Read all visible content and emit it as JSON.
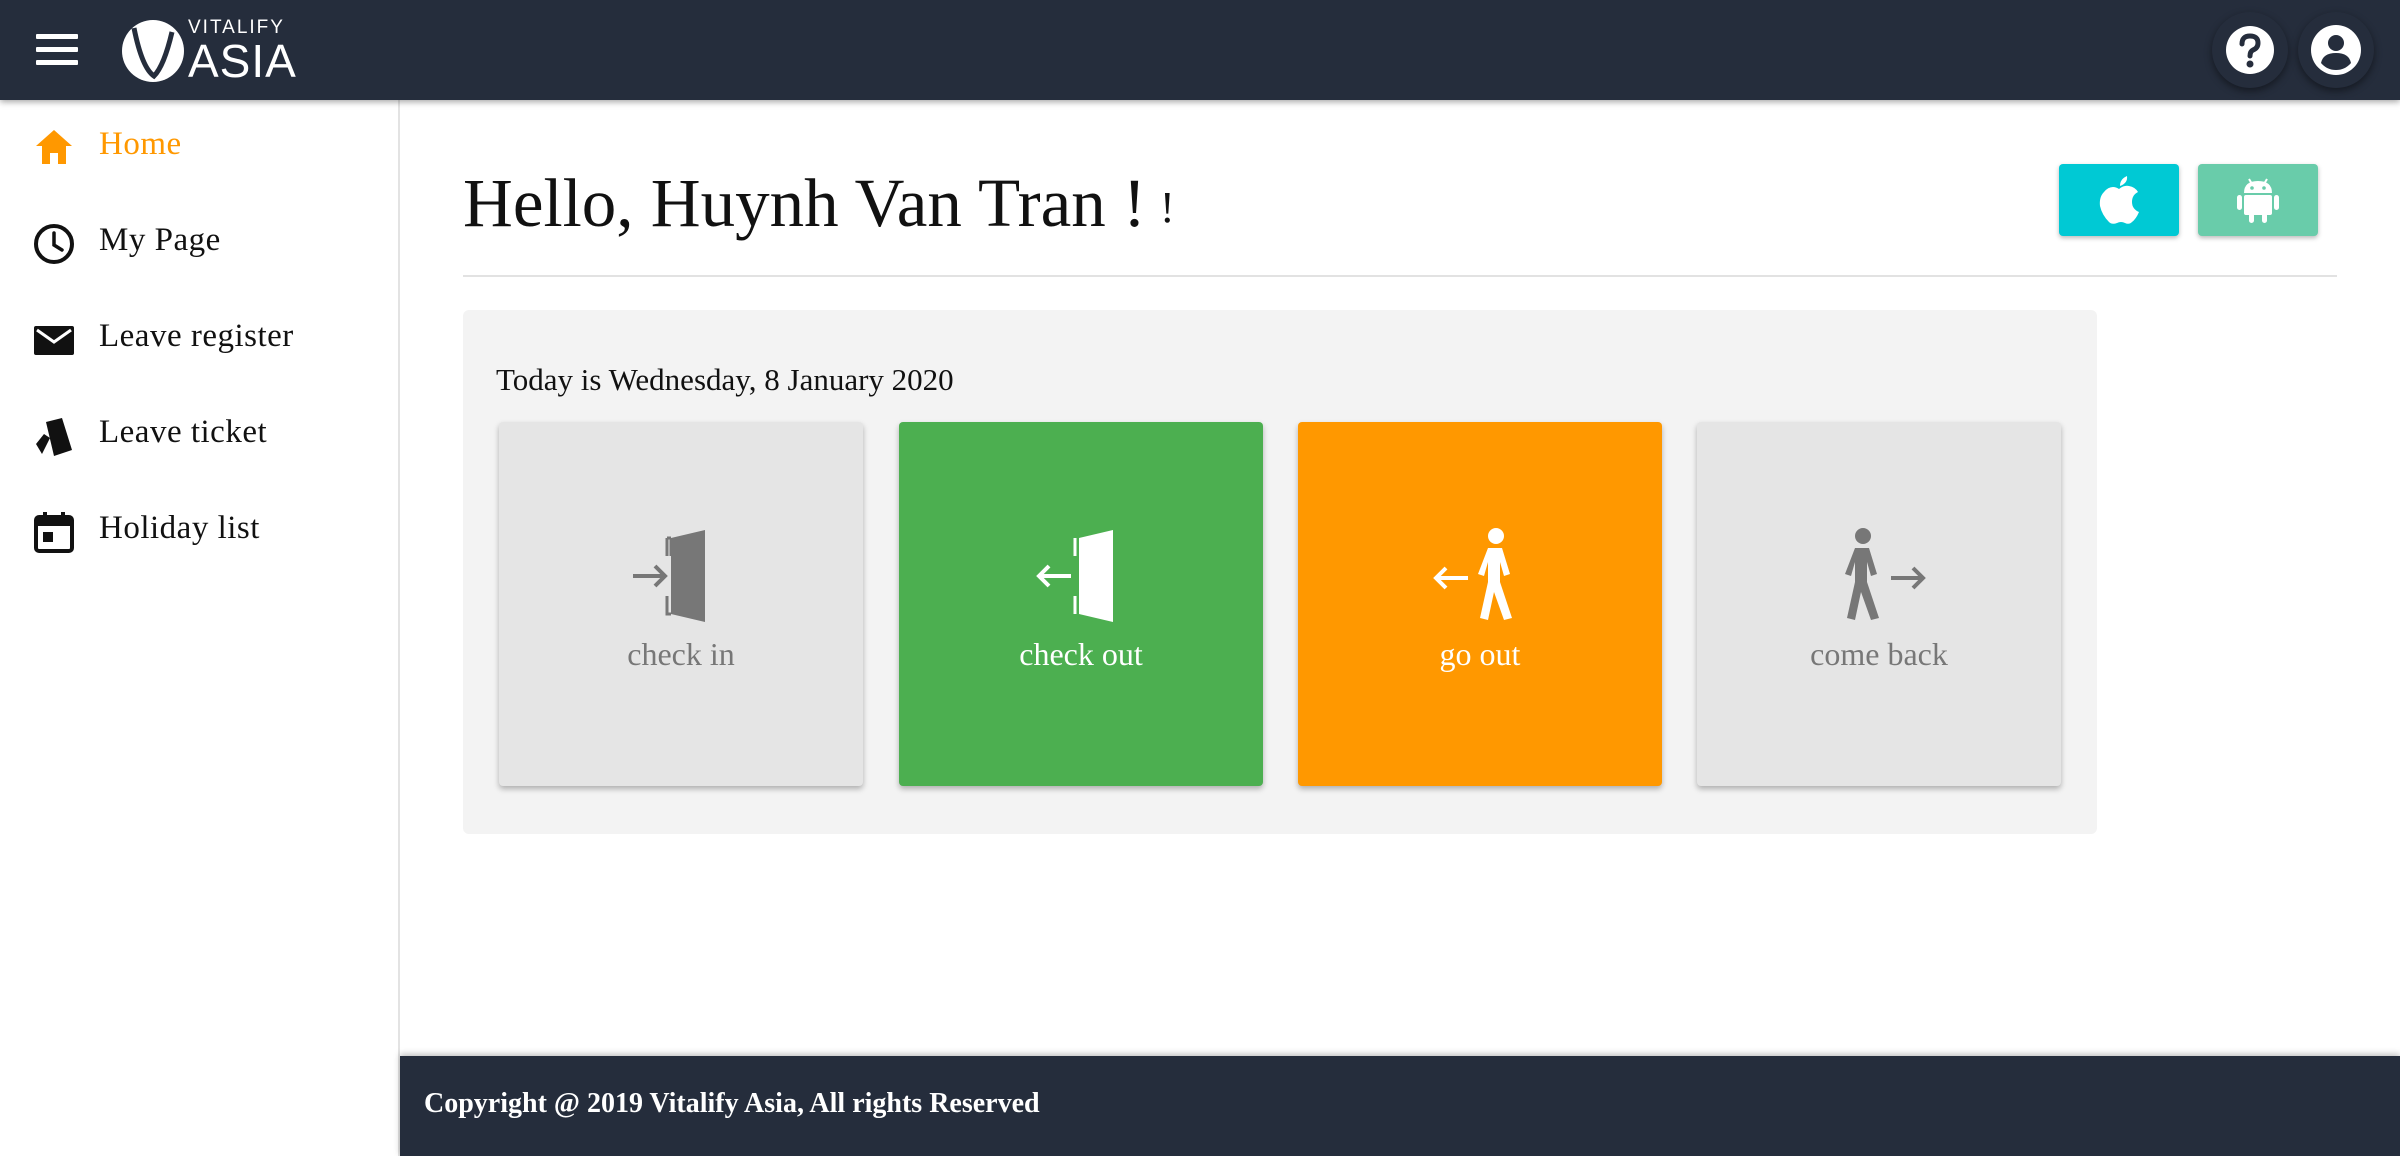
{
  "header": {
    "logo_small": "VITALIFY",
    "logo_big": "ASIA",
    "icons": [
      "menu-icon",
      "help-icon",
      "account-icon"
    ]
  },
  "sidebar": {
    "items": [
      {
        "label": "Home",
        "icon": "home-icon",
        "active": true
      },
      {
        "label": "My Page",
        "icon": "clock-icon",
        "active": false
      },
      {
        "label": "Leave register",
        "icon": "mail-icon",
        "active": false
      },
      {
        "label": "Leave ticket",
        "icon": "ticket-icon",
        "active": false
      },
      {
        "label": "Holiday list",
        "icon": "calendar-icon",
        "active": false
      }
    ]
  },
  "main": {
    "greeting": "Hello, Huynh Van Tran !",
    "greeting_extra": "!",
    "app_buttons": [
      {
        "icon": "apple-icon",
        "color": "#00c9d4"
      },
      {
        "icon": "android-icon",
        "color": "#69ccaa"
      }
    ],
    "date_text": "Today is Wednesday, 8 January 2020",
    "tiles": [
      {
        "label": "check in",
        "icon": "door-enter-icon",
        "color": "#e5e5e5"
      },
      {
        "label": "check out",
        "icon": "door-exit-icon",
        "color": "#4caf50"
      },
      {
        "label": "go out",
        "icon": "walk-out-icon",
        "color": "#ff9800"
      },
      {
        "label": "come back",
        "icon": "walk-back-icon",
        "color": "#e5e5e5"
      }
    ]
  },
  "footer": {
    "copyright": "Copyright @ 2019 Vitalify Asia, All rights Reserved"
  },
  "colors": {
    "topbar": "#252d3c",
    "accent": "#ff9800",
    "panel": "#f3f3f3"
  }
}
